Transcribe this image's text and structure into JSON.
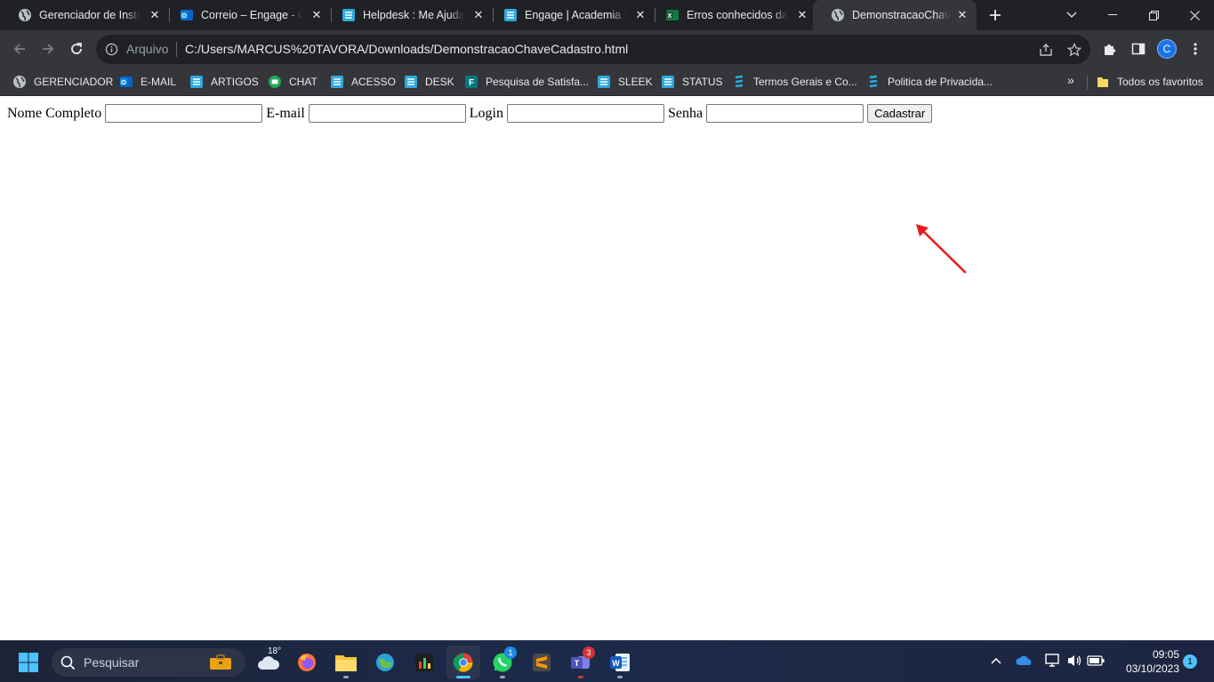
{
  "browser": {
    "tabs": [
      {
        "title": "Gerenciador de Instâncias",
        "icon": "globe-icon"
      },
      {
        "title": "Correio – Engage - Ca",
        "icon": "outlook-icon"
      },
      {
        "title": "Helpdesk : Me Ajuda,",
        "icon": "helpdesk-icon"
      },
      {
        "title": "Engage | Academia Er",
        "icon": "helpdesk-icon"
      },
      {
        "title": "Erros conhecidos da I",
        "icon": "excel-icon"
      },
      {
        "title": "DemonstracaoChaveC",
        "icon": "globe-icon",
        "active": true
      }
    ],
    "address": {
      "scheme_label": "Arquivo",
      "url": "C:/Users/MARCUS%20TAVORA/Downloads/DemonstracaoChaveCadastro.html"
    },
    "profile_initial": "C",
    "bookmarks": [
      {
        "label": "GERENCIADOR",
        "icon": "globe-icon"
      },
      {
        "label": "E-MAIL",
        "icon": "outlook-icon"
      },
      {
        "label": "ARTIGOS",
        "icon": "helpdesk-icon"
      },
      {
        "label": "CHAT",
        "icon": "chat-icon"
      },
      {
        "label": "ACESSO",
        "icon": "helpdesk-icon"
      },
      {
        "label": "DESK",
        "icon": "helpdesk-icon"
      },
      {
        "label": "Pesquisa de Satisfa...",
        "icon": "forms-icon"
      },
      {
        "label": "SLEEK",
        "icon": "helpdesk-icon"
      },
      {
        "label": "STATUS",
        "icon": "helpdesk-icon"
      },
      {
        "label": "Termos Gerais e Co...",
        "icon": "stripes-icon"
      },
      {
        "label": "Politica de Privacida...",
        "icon": "stripes-icon"
      }
    ],
    "all_bookmarks_label": "Todos os favoritos",
    "bookmarks_more": "»"
  },
  "page": {
    "form": {
      "name_label": "Nome Completo",
      "email_label": "E-mail",
      "login_label": "Login",
      "password_label": "Senha",
      "name_value": "",
      "email_value": "",
      "login_value": "",
      "password_value": "",
      "submit_label": "Cadastrar"
    },
    "annotation": {
      "color": "#e81c1c",
      "icon": "red-arrow-icon"
    }
  },
  "taskbar": {
    "search_label": "Pesquisar",
    "weather_temp": "18°",
    "whatsapp_badge": "1",
    "teams_badge": "3",
    "time": "09:05",
    "date": "03/10/2023",
    "notification_count": "1"
  },
  "colors": {
    "tabstrip": "#202124",
    "toolbar": "#35363a",
    "accent": "#1a73e8",
    "taskbar_accent": "#4cc2ff"
  }
}
